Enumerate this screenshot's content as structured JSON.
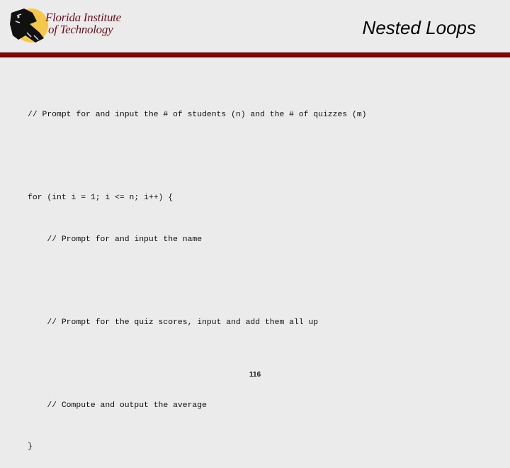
{
  "header": {
    "logo": {
      "icon": "panther-icon",
      "line1": "Florida Institute",
      "line2": "of Technology",
      "text_color": "#6b1020",
      "circle_color": "#f5c74a"
    },
    "title": "Nested Loops",
    "rule_color": "#8b0000"
  },
  "code": {
    "lines": [
      "// Prompt for and input the # of students (n) and the # of quizzes (m)",
      "",
      "for (int i = 1; i <= n; i++) {",
      "    // Prompt for and input the name",
      "",
      "    // Prompt for the quiz scores, input and add them all up",
      "",
      "    // Compute and output the average",
      "}"
    ]
  },
  "footer": {
    "page_number": "116"
  }
}
